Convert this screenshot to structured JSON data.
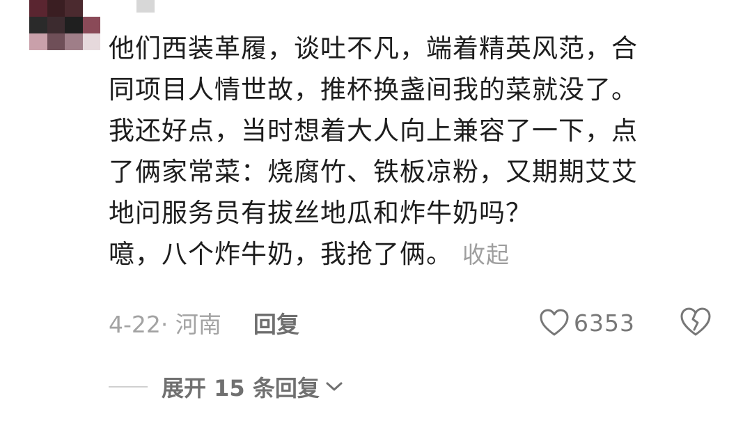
{
  "comment": {
    "lines": [
      "他们西装革履，谈吐不凡，端着精英风范，合",
      "同项目人情世故，推杯换盏间我的菜就没了。",
      "我还好点，当时想着大人向上兼容了一下，点",
      "了俩家常菜：烧腐竹、铁板凉粉，又期期艾艾",
      "地问服务员有拔丝地瓜和炸牛奶吗？",
      "噫，八个炸牛奶，我抢了俩。"
    ],
    "collapse_label": "收起"
  },
  "meta": {
    "date_location": "4-22· 河南",
    "reply_label": "回复"
  },
  "like": {
    "icon": "heart-outline-icon",
    "count": "6353"
  },
  "dislike": {
    "icon": "broken-heart-icon"
  },
  "expand": {
    "label": "展开 15 条回复",
    "icon": "chevron-down-icon"
  },
  "colors": {
    "text": "#1d1d1d",
    "muted": "#a3a3a3",
    "icon": "#777777"
  }
}
